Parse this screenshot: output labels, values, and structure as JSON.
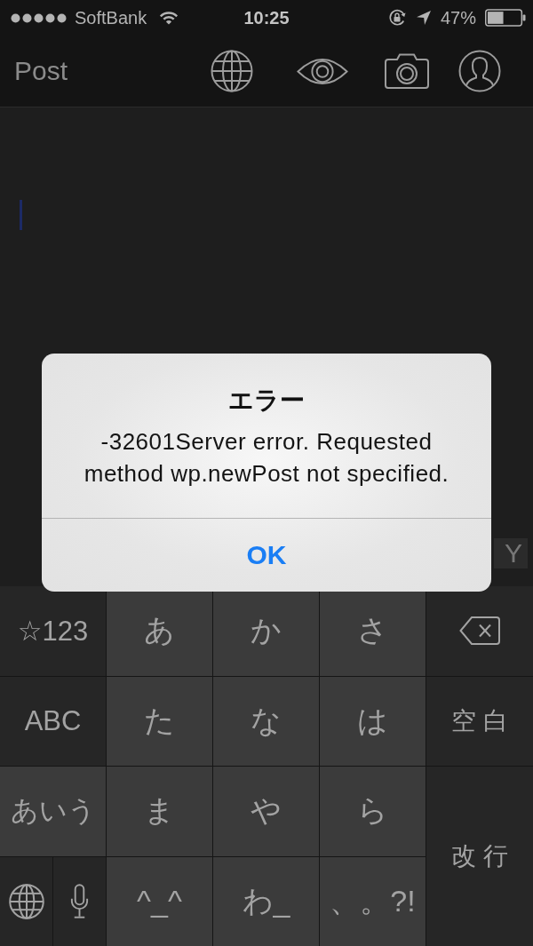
{
  "status_bar": {
    "carrier": "SoftBank",
    "time": "10:25",
    "battery": "47%"
  },
  "nav_bar": {
    "title": "Post",
    "buttons": [
      {
        "kind": "globe"
      },
      {
        "kind": "eye"
      },
      {
        "kind": "camera"
      },
      {
        "kind": "person"
      }
    ]
  },
  "editor": {
    "focused": true,
    "corner_label": "Y"
  },
  "alert": {
    "title": "エラー",
    "message": "-32601Server error. Requested method wp.newPost not specified.",
    "buttons": [
      "OK"
    ]
  },
  "keyboard": {
    "mode_keys": [
      {
        "label": "☆123",
        "selected": false
      },
      {
        "label": "ABC",
        "selected": false
      },
      {
        "label": "あいう",
        "selected": true
      }
    ],
    "keys": [
      {
        "kind": "kana",
        "label": "あ"
      },
      {
        "kind": "kana",
        "label": "か"
      },
      {
        "kind": "kana",
        "label": "さ"
      },
      {
        "kind": "delete"
      },
      {
        "kind": "kana",
        "label": "た"
      },
      {
        "kind": "kana",
        "label": "な"
      },
      {
        "kind": "kana",
        "label": "は"
      },
      {
        "kind": "space",
        "label": "空白"
      },
      {
        "kind": "kana",
        "label": "ま"
      },
      {
        "kind": "kana",
        "label": "や"
      },
      {
        "kind": "kana",
        "label": "ら"
      },
      {
        "kind": "return",
        "label": "改行"
      },
      {
        "kind": "globe"
      },
      {
        "kind": "mic"
      },
      {
        "kind": "kana",
        "label": "^_^"
      },
      {
        "kind": "kana",
        "label": "わ_"
      },
      {
        "kind": "kana",
        "label": "、。?!"
      }
    ]
  }
}
